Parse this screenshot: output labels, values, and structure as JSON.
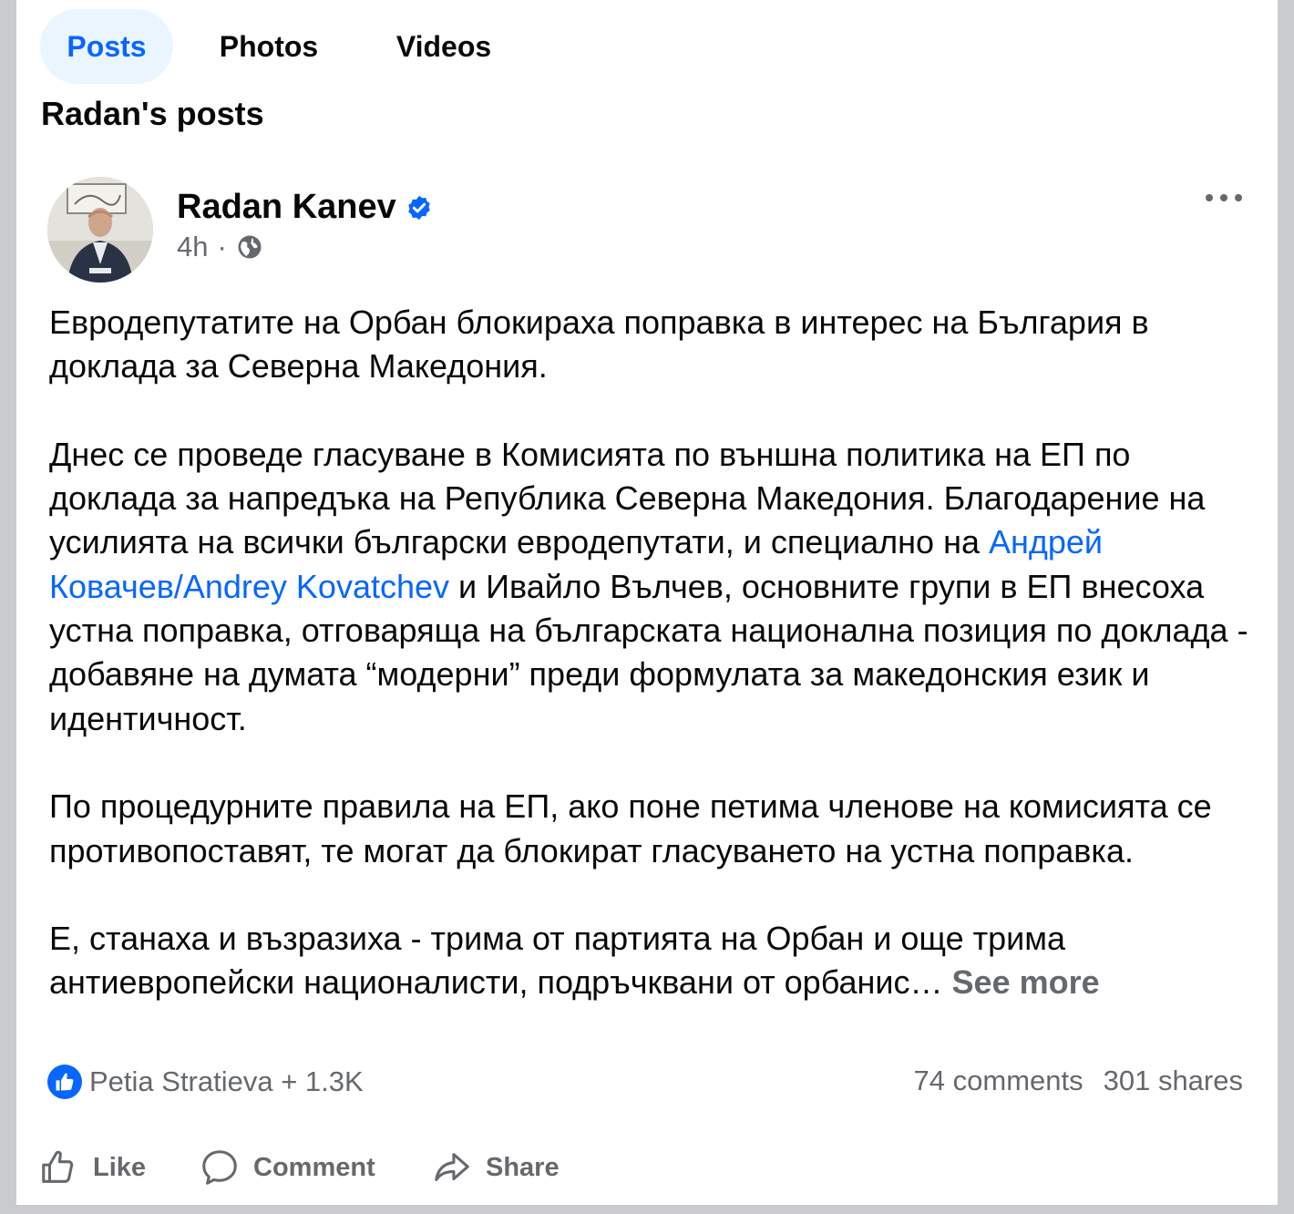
{
  "tabs": [
    {
      "label": "Posts",
      "active": true
    },
    {
      "label": "Photos",
      "active": false
    },
    {
      "label": "Videos",
      "active": false
    }
  ],
  "section_title": "Radan's posts",
  "post": {
    "author": "Radan Kanev",
    "verified": true,
    "time": "4h",
    "audience_icon": "globe-icon",
    "paragraphs": {
      "p1": "Евродепутатите на Орбан блокираха поправка в интерес на България в доклада за Северна Македония.",
      "p2_before": "Днес се проведе гласуване в Комисията по външна политика на ЕП по доклада за напредъка на Република Северна Македония. Благодарение на усилията на всички български евродепутати, и специално на ",
      "p2_mention": "Андрей Ковачев/Andrey Kovatchev",
      "p2_after": " и Ивайло Вълчев, основните групи в ЕП внесоха устна поправка, отговаряща на българската национална позиция по доклада - добавяне на думата “модерни” преди формулата за македонския език и идентичност.",
      "p3": "По процедурните правила на ЕП, ако поне петима членове на комисията се противопоставят, те могат да блокират гласуването на устна поправка.",
      "p4": "Е, станаха и възразиха - трима от партията на Орбан и още трима антиевропейски националисти, подръчквани от орбанис…",
      "see_more": "See more"
    },
    "reactions_text": "Petia Stratieva + 1.3K",
    "comments": "74 comments",
    "shares": "301 shares"
  },
  "actions": {
    "like": "Like",
    "comment": "Comment",
    "share": "Share"
  },
  "colors": {
    "accent": "#0866ff",
    "secondary_text": "#65686c",
    "active_tab_bg": "#ebf5ff"
  }
}
